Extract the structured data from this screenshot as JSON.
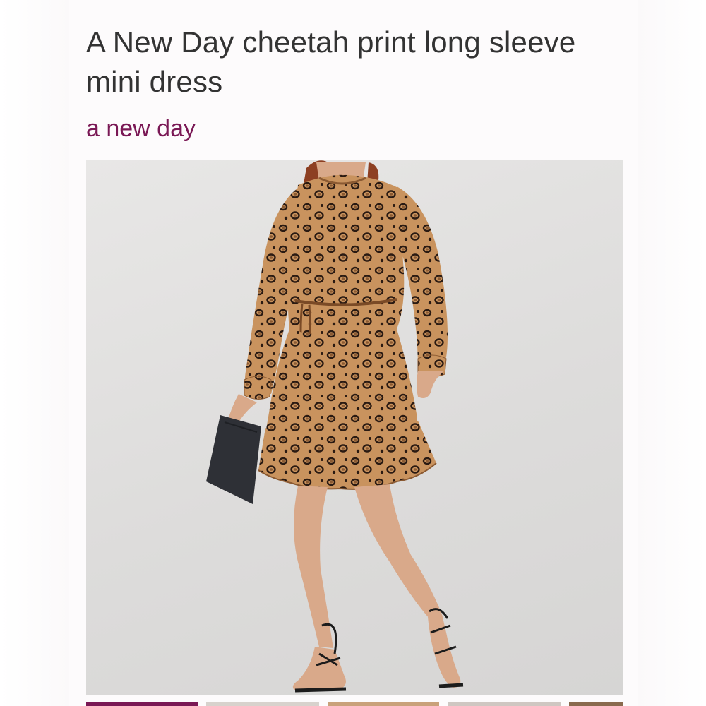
{
  "product": {
    "title": "A New Day cheetah print long sleeve mini dress",
    "brand": "a new day"
  },
  "hero_image": {
    "alt": "Model wearing cheetah print long sleeve mini dress holding a black clutch",
    "icon": "photo"
  },
  "thumbnails": [
    {
      "label": "thumbnail 1",
      "active": true
    },
    {
      "label": "thumbnail 2",
      "active": false
    },
    {
      "label": "thumbnail 3",
      "active": false
    },
    {
      "label": "thumbnail 4",
      "active": false
    },
    {
      "label": "thumbnail 5",
      "active": false
    }
  ],
  "colors": {
    "brand": "#7a1855",
    "title_text": "#333333",
    "dress_base": "#c9935e",
    "spots": "#2a1a12",
    "skin": "#d9a98a",
    "clutch": "#2e3036"
  }
}
